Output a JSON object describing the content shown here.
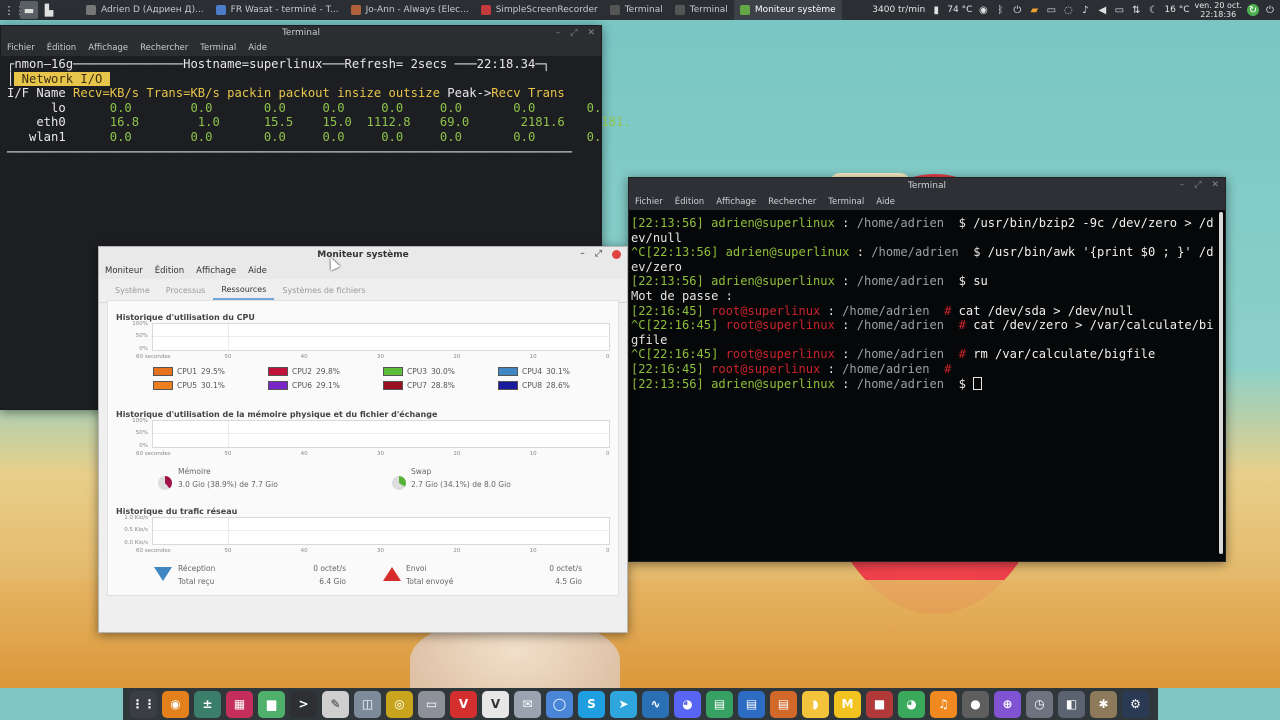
{
  "topbar": {
    "tasks": [
      {
        "label": "Adrien D (Адриен Д)...",
        "color": "#777777"
      },
      {
        "label": "FR Wasat - terminé - T...",
        "color": "#4a7cc7"
      },
      {
        "label": "Jo-Ann - Always (Elec...",
        "color": "#b0603a"
      },
      {
        "label": "SimpleScreenRecorder",
        "color": "#c23a3a"
      },
      {
        "label": "Terminal",
        "color": "#555555"
      },
      {
        "label": "Terminal",
        "color": "#555555"
      },
      {
        "label": "Moniteur système",
        "color": "#63a844"
      }
    ],
    "fan": "3400 tr/min",
    "cpu_temp": "74 °C",
    "weather": "16 °C",
    "date": "ven. 20 oct.",
    "time": "22:18:36"
  },
  "term1": {
    "title": "Terminal",
    "menu": [
      "Fichier",
      "Édition",
      "Affichage",
      "Rechercher",
      "Terminal",
      "Aide"
    ],
    "line0_a": "nmon—16g",
    "line0_b": "Hostname=superlinux",
    "line0_c": "Refresh= 2secs",
    "line0_d": "22:18.34",
    "tag": " Network I/O ",
    "head_ifname": "I/F Name",
    "head_cols": "Recv=KB/s Trans=KB/s packin packout insize outsize",
    "head_peak": "Peak->",
    "head_peakcols": "Recv Trans",
    "rows": [
      {
        "name": "lo",
        "vals": "0.0        0.0       0.0     0.0     0.0     0.0",
        "peak": "0.0       0."
      },
      {
        "name": "eth0",
        "vals": "16.8        1.0      15.5    15.0  1112.8    69.0",
        "peak": "2181.6     181."
      },
      {
        "name": "wlan1",
        "vals": "0.0        0.0       0.0     0.0     0.0     0.0",
        "peak": "0.0       0."
      }
    ]
  },
  "term2": {
    "title": "Terminal",
    "menu": [
      "Fichier",
      "Édition",
      "Affichage",
      "Rechercher",
      "Terminal",
      "Aide"
    ],
    "lines": [
      {
        "ts": "[22:13:56]",
        "user": "adrien@superlinux",
        "sep": " : ",
        "path": "/home/adrien",
        "sym": "  $ ",
        "cmd": "/usr/bin/bzip2 -9c /dev/zero > /d",
        "root": false
      },
      {
        "plain": "ev/null"
      },
      {
        "ts": "^C[22:13:56]",
        "user": "adrien@superlinux",
        "sep": " : ",
        "path": "/home/adrien",
        "sym": "  $ ",
        "cmd": "/usr/bin/awk '{print $0 ; }' /d",
        "root": false
      },
      {
        "plain": "ev/zero"
      },
      {
        "ts": "[22:13:56]",
        "user": "adrien@superlinux",
        "sep": " : ",
        "path": "/home/adrien",
        "sym": "  $ ",
        "cmd": "su",
        "root": false
      },
      {
        "plain": "Mot de passe :"
      },
      {
        "ts": "[22:16:45]",
        "user": "root@superlinux",
        "sep": " : ",
        "path": "/home/adrien",
        "sym": "  # ",
        "cmd": "cat /dev/sda > /dev/null",
        "root": true
      },
      {
        "ts": "^C[22:16:45]",
        "user": "root@superlinux",
        "sep": " : ",
        "path": "/home/adrien",
        "sym": "  # ",
        "cmd": "cat /dev/zero > /var/calculate/bi",
        "root": true
      },
      {
        "plain": "gfile"
      },
      {
        "ts": "^C[22:16:45]",
        "user": "root@superlinux",
        "sep": " : ",
        "path": "/home/adrien",
        "sym": "  # ",
        "cmd": "rm /var/calculate/bigfile",
        "root": true
      },
      {
        "ts": "[22:16:45]",
        "user": "root@superlinux",
        "sep": " : ",
        "path": "/home/adrien",
        "sym": "  # ",
        "cmd": "",
        "root": true
      },
      {
        "ts": "[22:13:56]",
        "user": "adrien@superlinux",
        "sep": " : ",
        "path": "/home/adrien",
        "sym": "  $ ",
        "cmd": "",
        "root": false,
        "cursor": true
      }
    ]
  },
  "monitor": {
    "title": "Moniteur système",
    "menu": [
      "Moniteur",
      "Édition",
      "Affichage",
      "Aide"
    ],
    "tabs": [
      "Système",
      "Processus",
      "Ressources",
      "Systèmes de fichiers"
    ],
    "active_tab": "Ressources",
    "cpu_title": "Historique d'utilisation du CPU",
    "mem_title": "Historique d'utilisation de la mémoire physique et du fichier d'échange",
    "net_title": "Historique du trafic réseau",
    "pct_labels": [
      "100%",
      "50%",
      "0%"
    ],
    "net_labels": [
      "1.0 Kio/s",
      "0.5 Kio/s",
      "0.0 Kio/s"
    ],
    "x_labels": [
      "60 secondes",
      "50",
      "40",
      "30",
      "20",
      "10",
      "0"
    ],
    "cpus": [
      {
        "label": "CPU1",
        "value": "29.5%",
        "color": "#e8731f"
      },
      {
        "label": "CPU2",
        "value": "29.8%",
        "color": "#c0123b"
      },
      {
        "label": "CPU3",
        "value": "30.0%",
        "color": "#5fbd3c"
      },
      {
        "label": "CPU4",
        "value": "30.1%",
        "color": "#3f86c2"
      },
      {
        "label": "CPU5",
        "value": "30.1%",
        "color": "#f07f21"
      },
      {
        "label": "CPU6",
        "value": "29.1%",
        "color": "#7a25c6"
      },
      {
        "label": "CPU7",
        "value": "28.8%",
        "color": "#9a1020"
      },
      {
        "label": "CPU8",
        "value": "28.6%",
        "color": "#1a1a9c"
      }
    ],
    "memory": {
      "label": "Mémoire",
      "detail": "3.0 Gio (38.9%) de 7.7 Gio",
      "color": "#a0134a"
    },
    "swap": {
      "label": "Swap",
      "detail": "2.7 Gio (34.1%) de 8.0 Gio",
      "color": "#58b23a"
    },
    "recv": {
      "label": "Réception",
      "rate": "0 octet/s",
      "total_label": "Total reçu",
      "total": "6.4 Gio"
    },
    "send": {
      "label": "Envoi",
      "rate": "0 octet/s",
      "total_label": "Total envoyé",
      "total": "4.5 Gio"
    }
  },
  "dock": [
    {
      "name": "app-grid",
      "color": "#3a3d43",
      "glyph": "⋮⋮"
    },
    {
      "name": "firefox",
      "color": "#e2801c",
      "glyph": "◉"
    },
    {
      "name": "calculator",
      "color": "#3b7f6a",
      "glyph": "±"
    },
    {
      "name": "apps",
      "color": "#c42e5a",
      "glyph": "▦"
    },
    {
      "name": "files",
      "color": "#4eb06a",
      "glyph": "▆"
    },
    {
      "name": "terminal",
      "color": "#2d2f33",
      "glyph": ">"
    },
    {
      "name": "editor",
      "color": "#cfcfcf",
      "glyph": "✎"
    },
    {
      "name": "screenshot",
      "color": "#7d8a9a",
      "glyph": "◫"
    },
    {
      "name": "sound",
      "color": "#c9a51d",
      "glyph": "◎"
    },
    {
      "name": "archive",
      "color": "#8d9098",
      "glyph": "▭"
    },
    {
      "name": "vivaldi",
      "color": "#d32f2f",
      "glyph": "V"
    },
    {
      "name": "vlc",
      "color": "#e7e7e7",
      "glyph": "V"
    },
    {
      "name": "mail",
      "color": "#9aa4b1",
      "glyph": "✉"
    },
    {
      "name": "chromium",
      "color": "#4a86d8",
      "glyph": "◯"
    },
    {
      "name": "skype",
      "color": "#1f9ee0",
      "glyph": "S"
    },
    {
      "name": "telegram",
      "color": "#2ea6dd",
      "glyph": "➤"
    },
    {
      "name": "monitor",
      "color": "#2b6fb5",
      "glyph": "∿"
    },
    {
      "name": "discord",
      "color": "#5865f2",
      "glyph": "◕"
    },
    {
      "name": "calc-sheet",
      "color": "#37a163",
      "glyph": "▤"
    },
    {
      "name": "writer",
      "color": "#2d6cc3",
      "glyph": "▤"
    },
    {
      "name": "impress",
      "color": "#d2692a",
      "glyph": "▤"
    },
    {
      "name": "banana",
      "color": "#f3c43b",
      "glyph": "◗"
    },
    {
      "name": "mcomix",
      "color": "#f2c21e",
      "glyph": "M"
    },
    {
      "name": "recorder",
      "color": "#b1393a",
      "glyph": "■"
    },
    {
      "name": "frog",
      "color": "#3aa95c",
      "glyph": "◕"
    },
    {
      "name": "audacity",
      "color": "#f08a20",
      "glyph": "♫"
    },
    {
      "name": "record",
      "color": "#5e5e5e",
      "glyph": "●"
    },
    {
      "name": "gamepad",
      "color": "#7f53d1",
      "glyph": "⊕"
    },
    {
      "name": "timer",
      "color": "#6d7480",
      "glyph": "◷"
    },
    {
      "name": "bottle",
      "color": "#5b6270",
      "glyph": "◧"
    },
    {
      "name": "tools",
      "color": "#8d7a5b",
      "glyph": "✱"
    },
    {
      "name": "steam",
      "color": "#2a3a55",
      "glyph": "⚙"
    }
  ]
}
